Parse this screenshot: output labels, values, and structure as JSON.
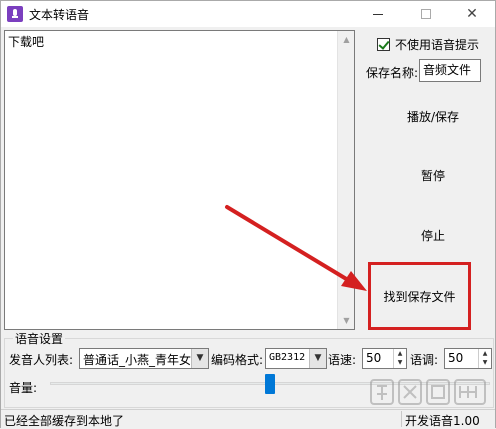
{
  "window": {
    "title": "文本转语音"
  },
  "editor": {
    "text": "下载吧"
  },
  "side": {
    "no_voice_prompt_label": "不使用语音提示",
    "no_voice_prompt_checked": true,
    "save_name_label": "保存名称:",
    "save_name_value": "音频文件",
    "play_save_label": "播放/保存",
    "pause_label": "暂停",
    "stop_label": "停止",
    "find_saved_label": "找到保存文件"
  },
  "voice_settings": {
    "group_title": "语音设置",
    "speaker_list_label": "发音人列表:",
    "speaker_value": "普通话_小燕_青年女",
    "encoding_label": "编码格式:",
    "encoding_value": "GB2312",
    "speed_label": "语速:",
    "speed_value": "50",
    "pitch_label": "语调:",
    "pitch_value": "50",
    "volume_label": "音量:",
    "volume_level": 0.5
  },
  "status": {
    "left_text": "已经全部缓存到本地了",
    "right_text": "开发语音1.00"
  },
  "annotation": {
    "highlight_color": "#d42020"
  },
  "colors": {
    "accent": "#0078d7",
    "check": "#1a7a1a"
  }
}
